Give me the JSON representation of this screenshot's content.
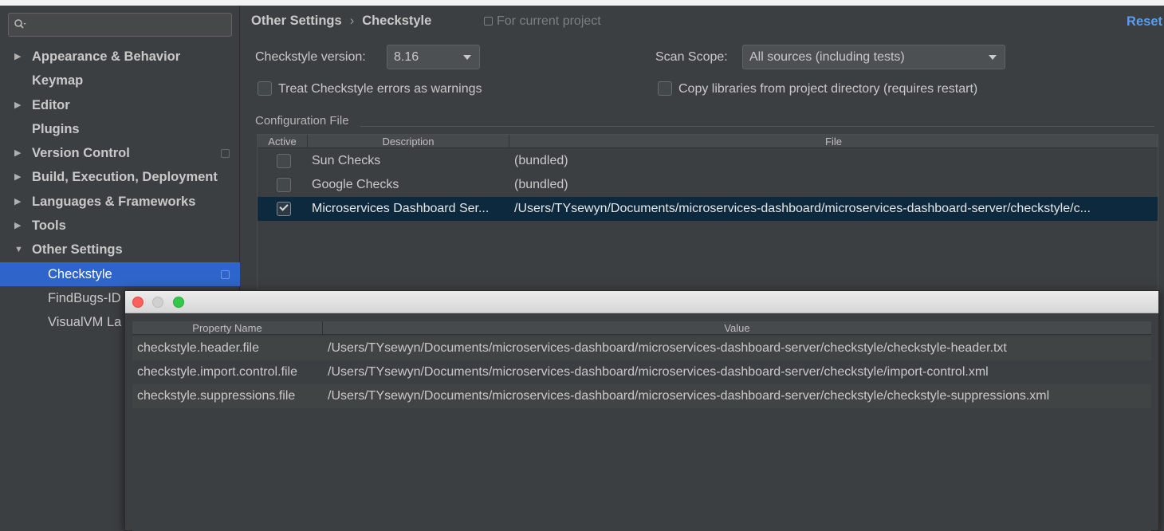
{
  "sidebar": {
    "search_placeholder": "",
    "items": [
      {
        "label": "Appearance & Behavior",
        "expand": "▶"
      },
      {
        "label": "Keymap",
        "expand": ""
      },
      {
        "label": "Editor",
        "expand": "▶"
      },
      {
        "label": "Plugins",
        "expand": ""
      },
      {
        "label": "Version Control",
        "expand": "▶"
      },
      {
        "label": "Build, Execution, Deployment",
        "expand": "▶"
      },
      {
        "label": "Languages & Frameworks",
        "expand": "▶"
      },
      {
        "label": "Tools",
        "expand": "▶"
      },
      {
        "label": "Other Settings",
        "expand": "▼"
      },
      {
        "label": "Checkstyle",
        "expand": ""
      },
      {
        "label": "FindBugs-ID",
        "expand": ""
      },
      {
        "label": "VisualVM La",
        "expand": ""
      }
    ]
  },
  "header": {
    "breadcrumb_parent": "Other Settings",
    "breadcrumb_sep": "›",
    "breadcrumb_current": "Checkstyle",
    "scope_note": "For current project",
    "reset_label": "Reset"
  },
  "settings": {
    "version_label": "Checkstyle version:",
    "version_value": "8.16",
    "scan_scope_label": "Scan Scope:",
    "scan_scope_value": "All sources (including tests)",
    "treat_errors_label": "Treat Checkstyle errors as warnings",
    "treat_errors_checked": false,
    "copy_libs_label": "Copy libraries from project directory (requires restart)",
    "copy_libs_checked": false,
    "config_file_label": "Configuration File"
  },
  "config_table": {
    "headers": {
      "active": "Active",
      "description": "Description",
      "file": "File"
    },
    "rows": [
      {
        "active": false,
        "description": "Sun Checks",
        "file": "(bundled)"
      },
      {
        "active": false,
        "description": "Google Checks",
        "file": "(bundled)"
      },
      {
        "active": true,
        "description": "Microservices Dashboard Ser...",
        "file": "/Users/TYsewyn/Documents/microservices-dashboard/microservices-dashboard-server/checkstyle/c..."
      }
    ]
  },
  "properties_dialog": {
    "headers": {
      "name": "Property Name",
      "value": "Value"
    },
    "rows": [
      {
        "name": "checkstyle.header.file",
        "value": "/Users/TYsewyn/Documents/microservices-dashboard/microservices-dashboard-server/checkstyle/checkstyle-header.txt"
      },
      {
        "name": "checkstyle.import.control.file",
        "value": "/Users/TYsewyn/Documents/microservices-dashboard/microservices-dashboard-server/checkstyle/import-control.xml"
      },
      {
        "name": "checkstyle.suppressions.file",
        "value": "/Users/TYsewyn/Documents/microservices-dashboard/microservices-dashboard-server/checkstyle/checkstyle-suppressions.xml"
      }
    ]
  },
  "colors": {
    "accent": "#2f65ca",
    "link": "#589df6",
    "background": "#3c3f41",
    "selected_row": "#0d293e"
  }
}
